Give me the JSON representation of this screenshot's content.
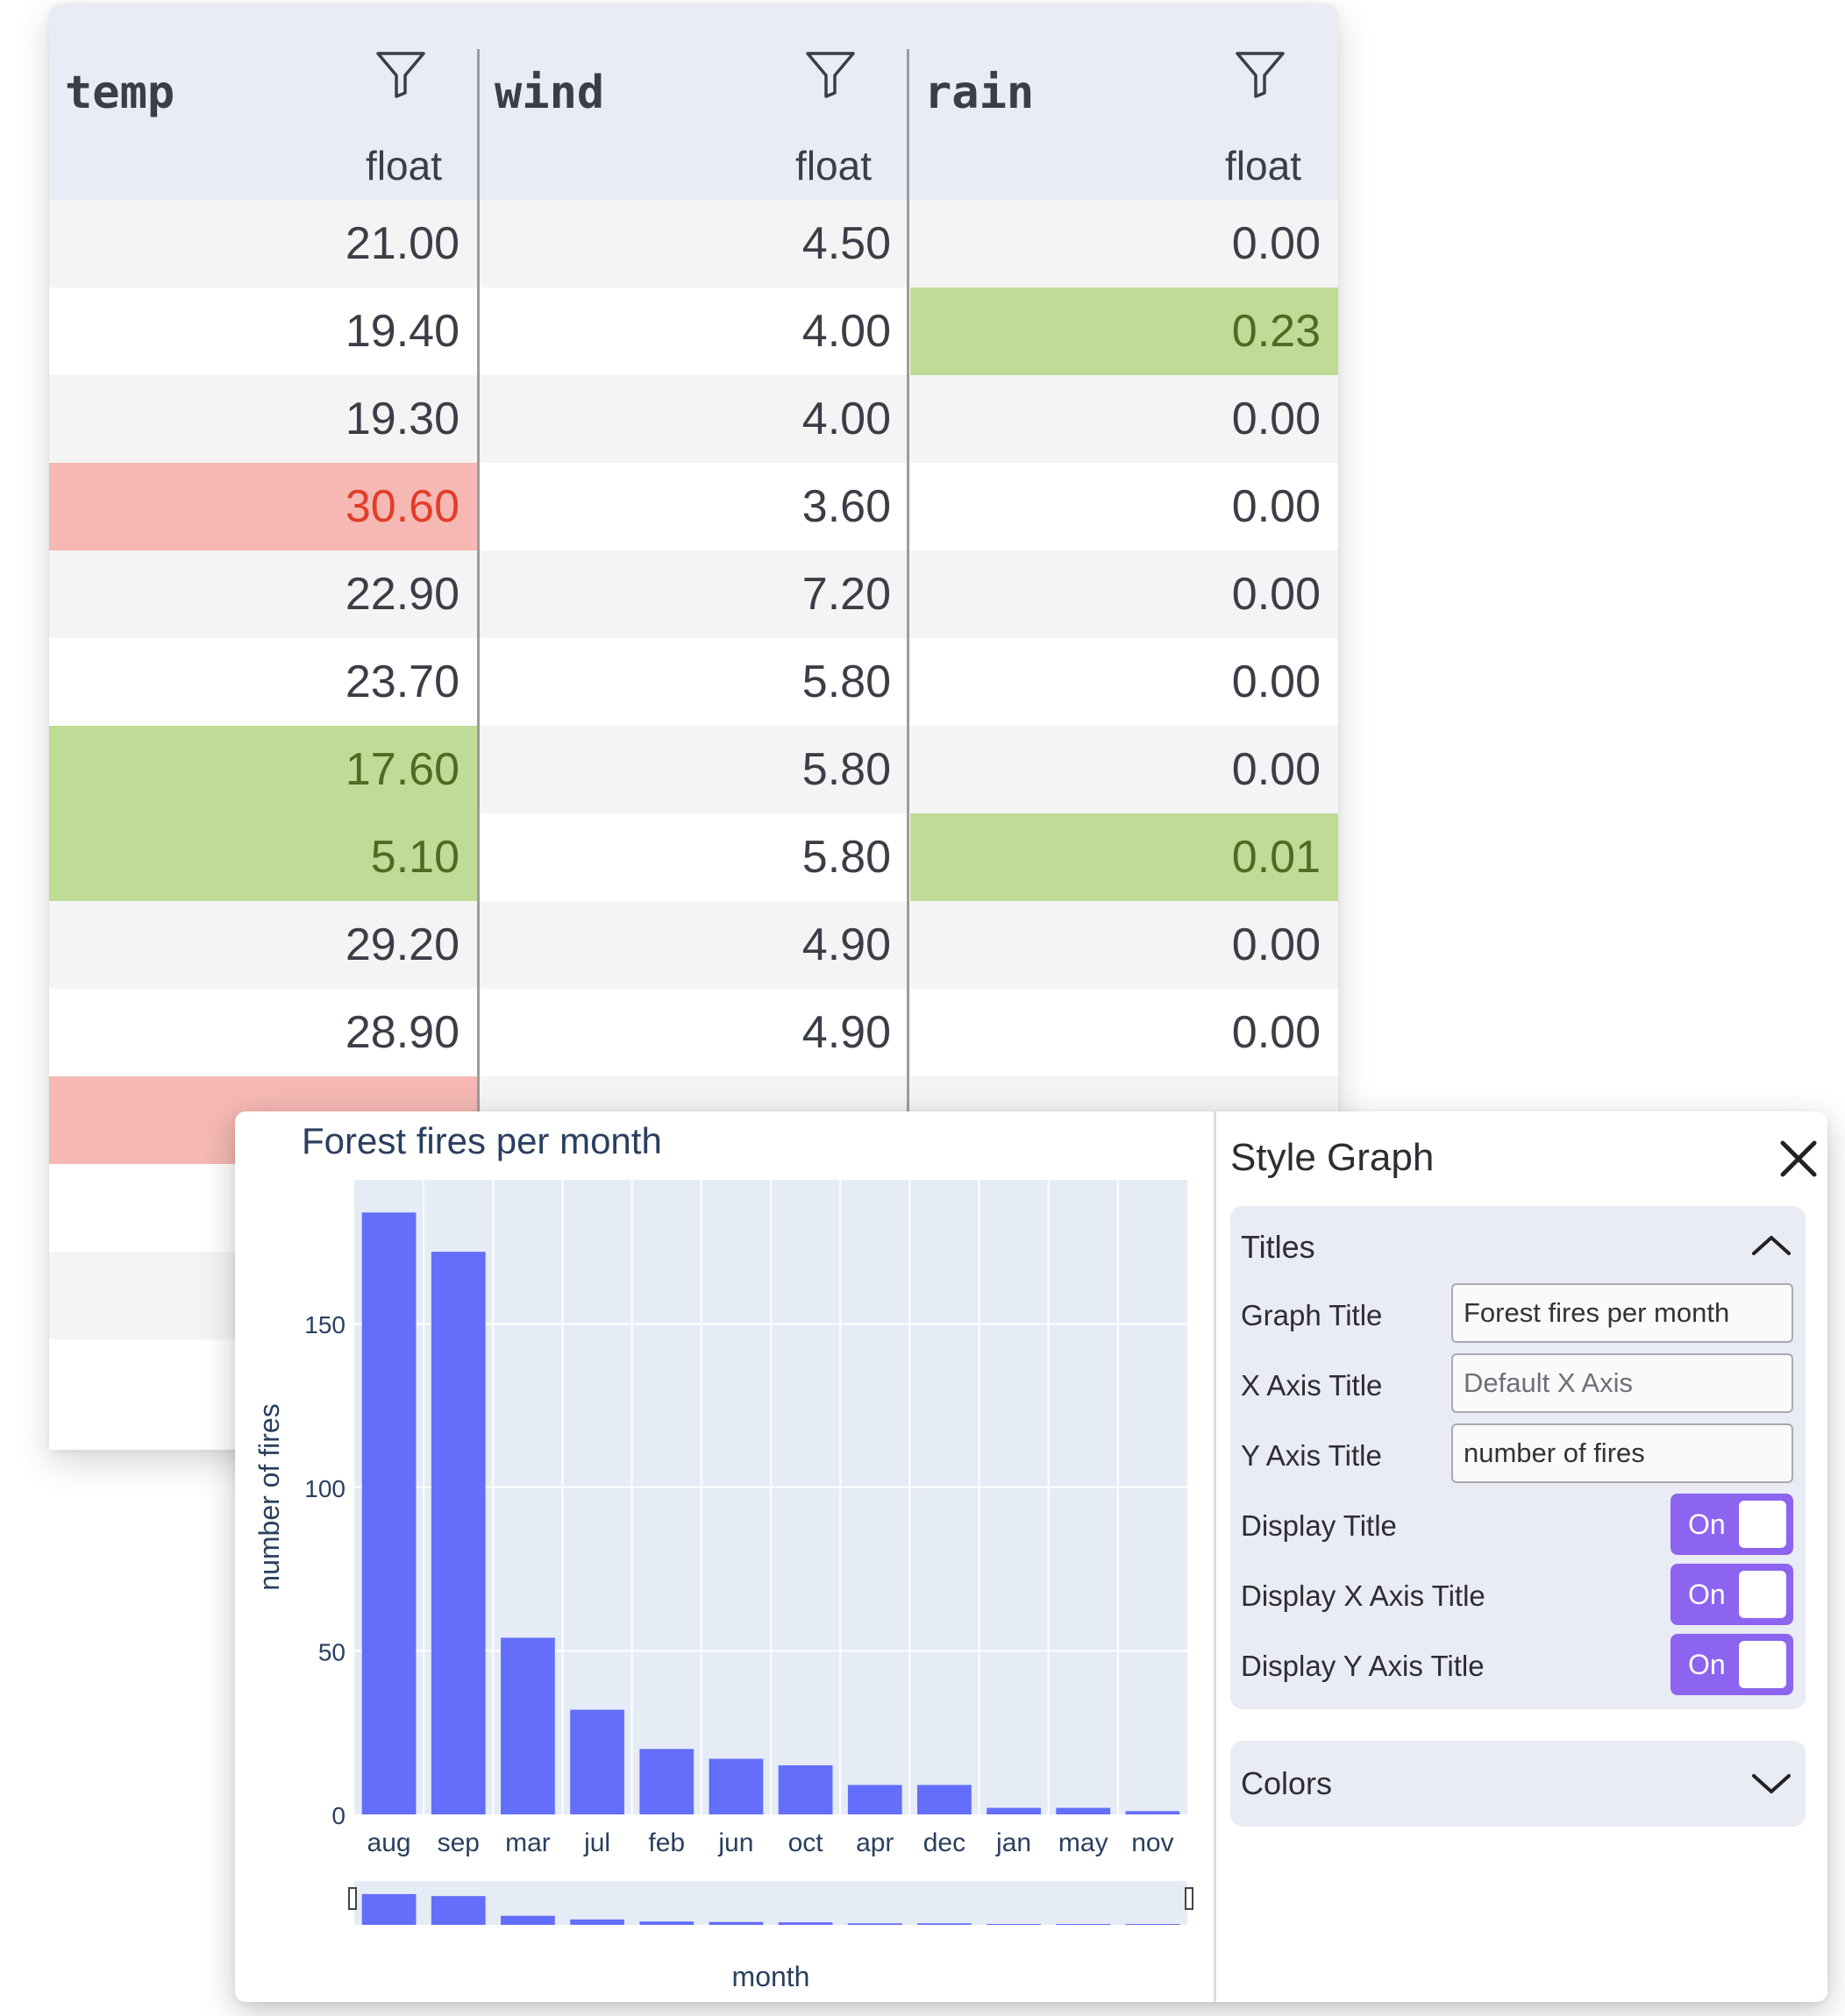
{
  "grid": {
    "columns": [
      {
        "name": "temp",
        "type": "float"
      },
      {
        "name": "wind",
        "type": "float"
      },
      {
        "name": "rain",
        "type": "float"
      }
    ],
    "rows": [
      {
        "values": [
          "21.00",
          "4.50",
          "0.00"
        ],
        "highlight": [
          "",
          "",
          ""
        ]
      },
      {
        "values": [
          "19.40",
          "4.00",
          "0.23"
        ],
        "highlight": [
          "",
          "",
          "low"
        ]
      },
      {
        "values": [
          "19.30",
          "4.00",
          "0.00"
        ],
        "highlight": [
          "",
          "",
          ""
        ]
      },
      {
        "values": [
          "30.60",
          "3.60",
          "0.00"
        ],
        "highlight": [
          "high",
          "",
          ""
        ]
      },
      {
        "values": [
          "22.90",
          "7.20",
          "0.00"
        ],
        "highlight": [
          "",
          "",
          ""
        ]
      },
      {
        "values": [
          "23.70",
          "5.80",
          "0.00"
        ],
        "highlight": [
          "",
          "",
          ""
        ]
      },
      {
        "values": [
          "17.60",
          "5.80",
          "0.00"
        ],
        "highlight": [
          "low",
          "",
          ""
        ]
      },
      {
        "values": [
          "5.10",
          "5.80",
          "0.01"
        ],
        "highlight": [
          "low",
          "",
          "low"
        ]
      },
      {
        "values": [
          "29.20",
          "4.90",
          "0.00"
        ],
        "highlight": [
          "",
          "",
          ""
        ]
      },
      {
        "values": [
          "28.90",
          "4.90",
          "0.00"
        ],
        "highlight": [
          "",
          "",
          ""
        ]
      },
      {
        "values": [
          "",
          "",
          ""
        ],
        "highlight": [
          "high",
          "",
          ""
        ]
      },
      {
        "values": [
          "",
          "",
          ""
        ],
        "highlight": [
          "",
          "",
          ""
        ]
      },
      {
        "values": [
          "",
          "",
          ""
        ],
        "highlight": [
          "",
          "",
          ""
        ]
      },
      {
        "values": [
          "",
          "",
          ""
        ],
        "highlight": [
          "",
          "",
          ""
        ]
      }
    ],
    "colors": {
      "low": "#bedc96",
      "high": "#f5b8b3",
      "header": "#e9ebf5"
    }
  },
  "chart_data": {
    "type": "bar",
    "title": "Forest fires per month",
    "xlabel": "month",
    "ylabel": "number of fires",
    "categories": [
      "aug",
      "sep",
      "mar",
      "jul",
      "feb",
      "jun",
      "oct",
      "apr",
      "dec",
      "jan",
      "may",
      "nov"
    ],
    "values": [
      184,
      172,
      54,
      32,
      20,
      17,
      15,
      9,
      9,
      2,
      2,
      1
    ],
    "ylim": [
      0,
      194
    ],
    "yticks": [
      0,
      50,
      100,
      150
    ],
    "bar_color": "#636efa",
    "plot_bg": "#e5ecf6",
    "rangeslider": true
  },
  "style_panel": {
    "title": "Style Graph",
    "close_icon": "close-icon",
    "titles_section": {
      "label": "Titles",
      "graph_title_label": "Graph Title",
      "graph_title_value": "Forest fires per month",
      "x_axis_title_label": "X Axis Title",
      "x_axis_title_placeholder": "Default X Axis",
      "y_axis_title_label": "Y Axis Title",
      "y_axis_title_value": "number of fires",
      "display_title_label": "Display Title",
      "display_x_label": "Display X Axis Title",
      "display_y_label": "Display Y Axis Title",
      "toggle_on_text": "On"
    },
    "colors_section": {
      "label": "Colors"
    },
    "accent_color": "#8c64ef"
  }
}
